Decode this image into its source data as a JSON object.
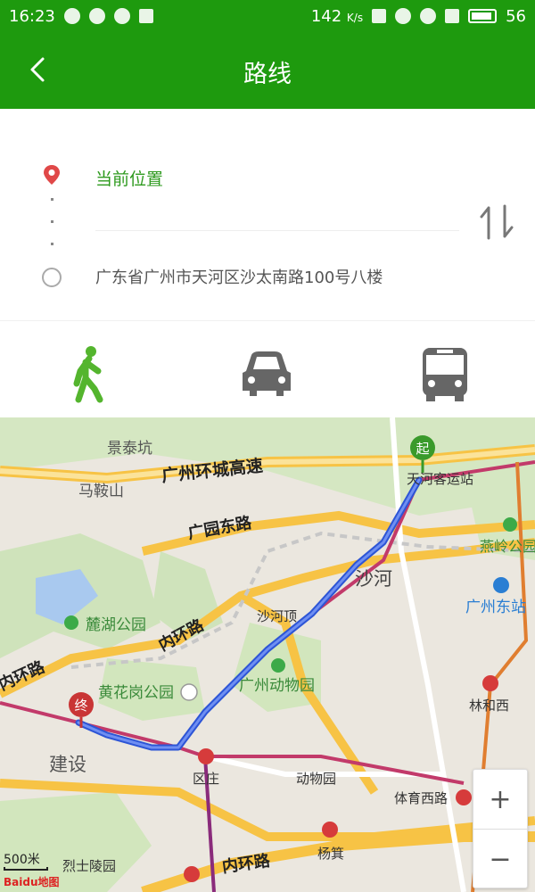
{
  "status_bar": {
    "time": "16:23",
    "speed": "142",
    "speed_unit": "K/s",
    "battery": "56"
  },
  "header": {
    "title": "路线"
  },
  "route": {
    "origin": "当前位置",
    "destination": "广东省广州市天河区沙太南路100号八楼"
  },
  "modes": [
    "walk",
    "car",
    "bus"
  ],
  "map": {
    "labels": [
      "景泰坑",
      "广州环城高速",
      "马鞍山",
      "广园东路",
      "沙河",
      "麓湖公园",
      "沙河顶",
      "内环路",
      "广州动物园",
      "黄花岗公园",
      "内环路",
      "建设",
      "区庄",
      "动物园",
      "林和西",
      "广州东站",
      "燕岭公园",
      "天河客运站",
      "体育西路",
      "烈士陵园",
      "杨箕",
      "内环路"
    ],
    "start_marker": "起",
    "end_marker": "终",
    "scale": "500米",
    "logo_text": "Baidu地图"
  },
  "colors": {
    "header": "#1e9a0e",
    "route": "#3a64d8",
    "origin_text": "#2e9a1e"
  }
}
